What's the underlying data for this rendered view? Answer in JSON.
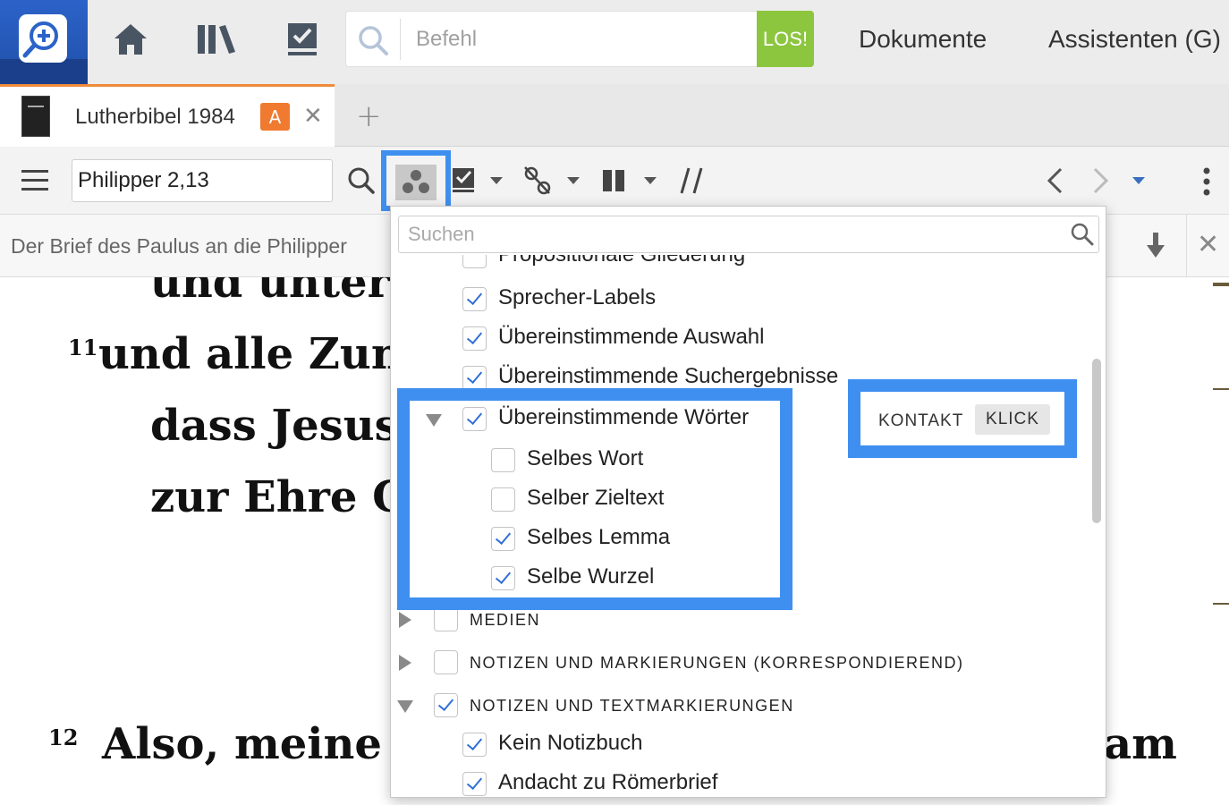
{
  "topbar": {
    "command_placeholder": "Befehl",
    "go_label": "LOS!",
    "menu": [
      "Dokumente",
      "Assistenten (G)"
    ]
  },
  "tab": {
    "title": "Lutherbibel 1984",
    "badge": "A"
  },
  "toolbar": {
    "reference": "Philipper 2,13"
  },
  "subheader": {
    "book_name": "Der Brief des Paulus an die Philipper"
  },
  "bible": {
    "lines": [
      {
        "verse": "",
        "text": "und unter d"
      },
      {
        "verse": "11",
        "text": "und alle Zung"
      },
      {
        "verse": "",
        "text": "dass Jesus C"
      },
      {
        "verse": "",
        "text": "zur Ehre Go"
      },
      {
        "verse": "12",
        "text": "Also,   meine"
      },
      {
        "verse": "",
        "text": "am"
      }
    ]
  },
  "dropdown": {
    "search_placeholder": "Suchen",
    "items": [
      {
        "label": "Propositionale Gliederung",
        "checked": false
      },
      {
        "label": "Sprecher-Labels",
        "checked": true
      },
      {
        "label": "Übereinstimmende Auswahl",
        "checked": true
      },
      {
        "label": "Übereinstimmende Suchergebnisse",
        "checked": true
      },
      {
        "label": "Übereinstimmende Wörter",
        "checked": true
      },
      {
        "label": "Selbes Wort",
        "checked": false
      },
      {
        "label": "Selber Zieltext",
        "checked": false
      },
      {
        "label": "Selbes Lemma",
        "checked": true
      },
      {
        "label": "Selbe Wurzel",
        "checked": true
      },
      {
        "label": "MEDIEN",
        "checked": false
      },
      {
        "label": "NOTIZEN UND MARKIERUNGEN (KORRESPONDIEREND)",
        "checked": false
      },
      {
        "label": "NOTIZEN UND TEXTMARKIERUNGEN",
        "checked": true
      },
      {
        "label": "Kein Notizbuch",
        "checked": true
      },
      {
        "label": "Andacht zu Römerbrief",
        "checked": true
      }
    ]
  },
  "contact": {
    "kontakt": "KONTAKT",
    "klick": "KLICK"
  },
  "colors": {
    "accent_blue": "#3f8ff0",
    "go_green": "#8cc63f",
    "badge_orange": "#f07a2f",
    "check_blue": "#2f6fd8"
  }
}
